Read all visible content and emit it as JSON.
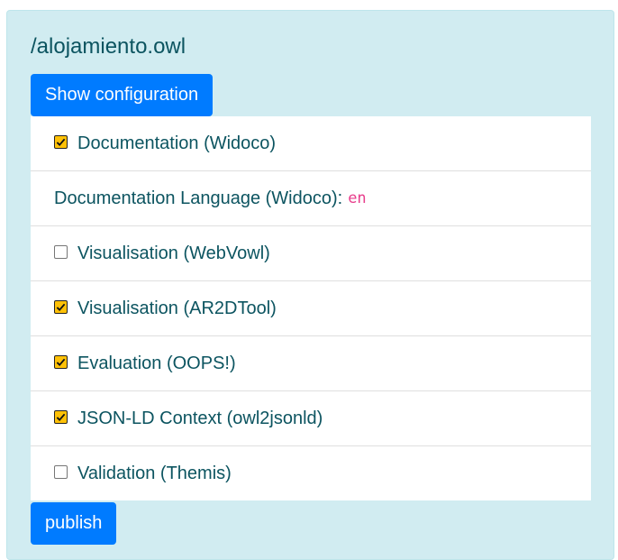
{
  "page": {
    "title": "/alojamiento.owl",
    "show_config_label": "Show configuration",
    "publish_label": "publish"
  },
  "options": [
    {
      "label": "Documentation (Widoco)",
      "checked": true
    },
    {
      "label": "Documentation Language (Widoco):",
      "value": "en"
    },
    {
      "label": "Visualisation (WebVowl)",
      "checked": false
    },
    {
      "label": "Visualisation (AR2DTool)",
      "checked": true
    },
    {
      "label": "Evaluation (OOPS!)",
      "checked": true
    },
    {
      "label": "JSON-LD Context (owl2jsonld)",
      "checked": true
    },
    {
      "label": "Validation (Themis)",
      "checked": false
    }
  ],
  "colors": {
    "panel_bg": "#d1ecf1",
    "text": "#0c5460",
    "button": "#007bff",
    "checkbox_checked": "#ffc107",
    "lang_code": "#e83e8c"
  }
}
